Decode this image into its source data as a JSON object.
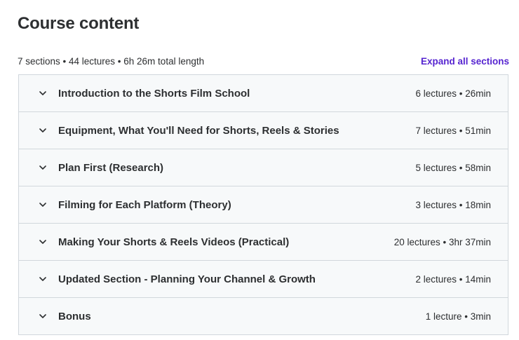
{
  "header": {
    "title": "Course content",
    "summary": "7 sections • 44 lectures • 6h 26m total length",
    "expand_all_label": "Expand all sections"
  },
  "sections": [
    {
      "title": "Introduction to the Shorts Film School",
      "meta": "6 lectures • 26min"
    },
    {
      "title": "Equipment, What You'll Need for Shorts, Reels & Stories",
      "meta": "7 lectures • 51min"
    },
    {
      "title": "Plan First (Research)",
      "meta": "5 lectures • 58min"
    },
    {
      "title": "Filming for Each Platform (Theory)",
      "meta": "3 lectures • 18min"
    },
    {
      "title": "Making Your Shorts & Reels Videos (Practical)",
      "meta": "20 lectures • 3hr 37min"
    },
    {
      "title": "Updated Section - Planning Your Channel & Growth",
      "meta": "2 lectures • 14min"
    },
    {
      "title": "Bonus",
      "meta": "1 lecture • 3min"
    }
  ],
  "icons": {
    "section_toggle": "chevron-down-icon"
  },
  "colors": {
    "accent": "#5624d0",
    "text": "#2d2f31",
    "row_background": "#f7f9fa",
    "border": "#d1d7dc"
  }
}
